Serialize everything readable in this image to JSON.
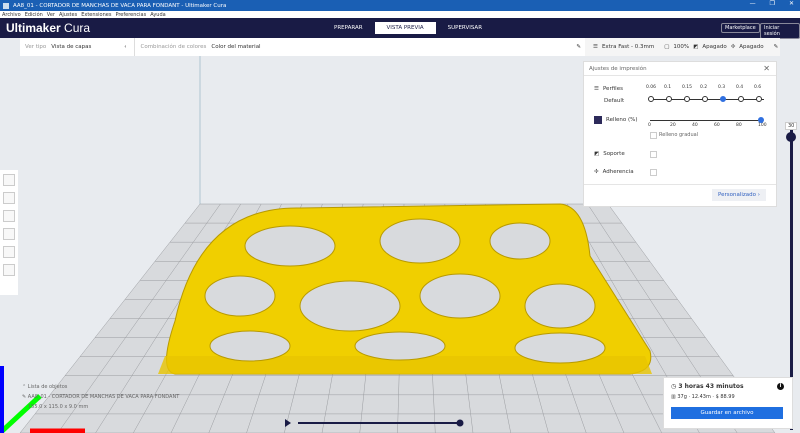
{
  "window": {
    "title": "AA8_01 - CORTADOR DE MANCHAS DE VACA PARA FONDANT - Ultimaker Cura",
    "controls": [
      "—",
      "❐",
      "✕"
    ]
  },
  "menu": [
    "Archivo",
    "Edición",
    "Ver",
    "Ajustes",
    "Extensiones",
    "Preferencias",
    "Ayuda"
  ],
  "header": {
    "logo_bold": "Ultimaker",
    "logo_light": "Cura",
    "stages": [
      "PREPARAR",
      "VISTA PREVIA",
      "SUPERVISAR"
    ],
    "marketplace": "Marketplace",
    "signin": "Iniciar sesión"
  },
  "viewbar": {
    "view_type_label": "Ver tipo",
    "view_type": "Vista de capas",
    "color_scheme_label": "Combinación de colores",
    "color_scheme": "Color del material"
  },
  "settings_bar": {
    "profile": "Extra Fast - 0.3mm",
    "infill": "100%",
    "support": "Apagado",
    "adhesion": "Apagado"
  },
  "print_settings": {
    "title": "Ajustes de impresión",
    "profiles_label": "Perfiles",
    "profile_name": "Default",
    "layer_heights": [
      "0.06",
      "0.1",
      "0.15",
      "0.2",
      "0.3",
      "0.4",
      "0.6"
    ],
    "selected_layer_height": "0.3",
    "infill_label": "Relleno (%)",
    "infill_ticks": [
      "0",
      "20",
      "40",
      "60",
      "80",
      "100"
    ],
    "infill_value": 100,
    "gradual_label": "Relleno gradual",
    "support_label": "Soporte",
    "adhesion_label": "Adherencia",
    "custom_button": "Personalizado"
  },
  "object": {
    "list_label": "Lista de objetos",
    "name": "AA8_01 - CORTADOR DE MANCHAS DE VACA PARA FONDANT",
    "dimensions": "155.0 x 115.0 x 9.0 mm"
  },
  "print_info": {
    "time": "3 horas 43 minutos",
    "material": "37g · 12.43m · $ 88.99",
    "save_button": "Guardar en archivo"
  },
  "layer_view": {
    "current_layer": "30"
  },
  "colors": {
    "header": "#191b45",
    "accent": "#1f6fe0",
    "model": "#f5d800"
  }
}
